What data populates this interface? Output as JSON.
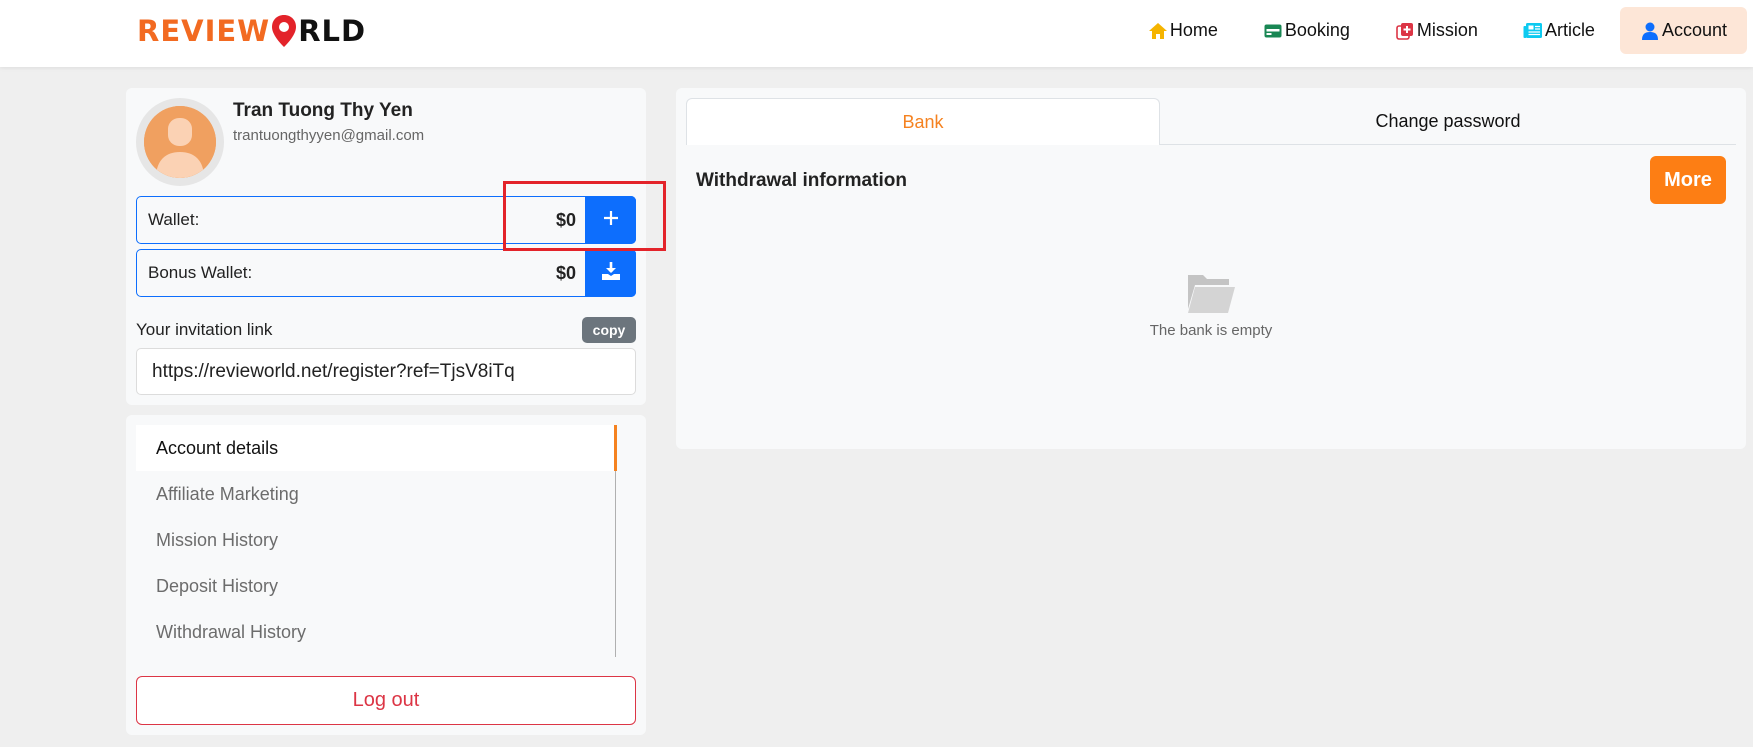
{
  "header": {
    "logo_part1": "REVIEW",
    "logo_part2": "RLD",
    "nav": [
      {
        "label": "Home",
        "icon": "home-icon"
      },
      {
        "label": "Booking",
        "icon": "ticket-icon"
      },
      {
        "label": "Mission",
        "icon": "mission-icon"
      },
      {
        "label": "Article",
        "icon": "newspaper-icon"
      },
      {
        "label": "Account",
        "icon": "user-icon",
        "active": true
      }
    ]
  },
  "profile": {
    "name": "Tran Tuong Thy Yen",
    "email": "trantuongthyyen@gmail.com"
  },
  "wallet": {
    "label": "Wallet:",
    "amount": "$0",
    "action_icon": "plus-icon"
  },
  "bonus_wallet": {
    "label": "Bonus Wallet:",
    "amount": "$0",
    "action_icon": "download-icon"
  },
  "invitation": {
    "label": "Your invitation link",
    "copy_label": "copy",
    "link": "https://revieworld.net/register?ref=TjsV8iTq"
  },
  "menu": {
    "items": [
      {
        "label": "Account details",
        "active": true
      },
      {
        "label": "Affiliate Marketing"
      },
      {
        "label": "Mission History"
      },
      {
        "label": "Deposit History"
      },
      {
        "label": "Withdrawal History"
      }
    ],
    "logout_label": "Log out"
  },
  "main": {
    "tabs": [
      {
        "label": "Bank",
        "active": true
      },
      {
        "label": "Change password"
      }
    ],
    "section_title": "Withdrawal information",
    "more_label": "More",
    "empty_text": "The bank is empty"
  },
  "colors": {
    "brand_orange": "#f26a21",
    "primary_blue": "#0d6efd",
    "danger_red": "#dc3545",
    "highlight_red": "#e3232a"
  }
}
